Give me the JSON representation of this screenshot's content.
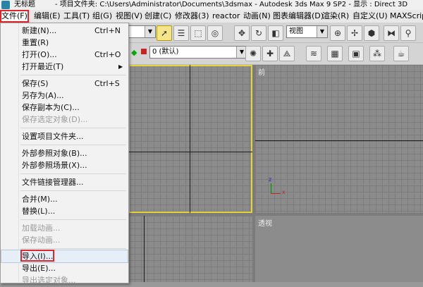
{
  "title_bar": {
    "app_name": "无标题",
    "title_text": "- 项目文件夹: C:\\Users\\Administrator\\Documents\\3dsmax   - Autodesk 3ds Max 9 SP2   - 显示 : Direct 3D"
  },
  "menubar": {
    "items": [
      "文件(F)",
      "编辑(E)",
      "工具(T)",
      "组(G)",
      "视图(V)",
      "创建(C)",
      "修改器(3)",
      "reactor",
      "动画(N)",
      "图表编辑器(D)",
      "渲染(R)",
      "自定义(U)",
      "MAXScript"
    ]
  },
  "toolbar": {
    "view_combo": "视图",
    "layer_combo": "0 (默认)"
  },
  "viewports": {
    "front_label": "前",
    "persp_label": "透视",
    "gizmo_x": "x",
    "gizmo_z": "z"
  },
  "file_menu": {
    "items": [
      {
        "label": "新建(N)...",
        "shortcut": "Ctrl+N",
        "disabled": false
      },
      {
        "label": "重置(R)",
        "shortcut": "",
        "disabled": false
      },
      {
        "label": "打开(O)...",
        "shortcut": "Ctrl+O",
        "disabled": false
      },
      {
        "label": "打开最近(T)",
        "shortcut": "",
        "disabled": false,
        "submenu": true
      },
      {
        "label": "保存(S)",
        "shortcut": "Ctrl+S",
        "disabled": false
      },
      {
        "label": "另存为(A)...",
        "shortcut": "",
        "disabled": false
      },
      {
        "label": "保存副本为(C)...",
        "shortcut": "",
        "disabled": false
      },
      {
        "label": "保存选定对象(D)...",
        "shortcut": "",
        "disabled": true
      },
      {
        "label": "设置项目文件夹...",
        "shortcut": "",
        "disabled": false
      },
      {
        "label": "外部参照对象(B)...",
        "shortcut": "",
        "disabled": false
      },
      {
        "label": "外部参照场景(X)...",
        "shortcut": "",
        "disabled": false
      },
      {
        "label": "文件链接管理器...",
        "shortcut": "",
        "disabled": false
      },
      {
        "label": "合并(M)...",
        "shortcut": "",
        "disabled": false
      },
      {
        "label": "替换(L)...",
        "shortcut": "",
        "disabled": false
      },
      {
        "label": "加载动画...",
        "shortcut": "",
        "disabled": true
      },
      {
        "label": "保存动画...",
        "shortcut": "",
        "disabled": true
      },
      {
        "label": "导入(I)...",
        "shortcut": "",
        "disabled": false
      },
      {
        "label": "导出(E)...",
        "shortcut": "",
        "disabled": false
      },
      {
        "label": "导出选定对象...",
        "shortcut": "",
        "disabled": true
      }
    ]
  },
  "colors": {
    "highlight": "#e0262d",
    "active_viewport": "#e8d23a"
  }
}
